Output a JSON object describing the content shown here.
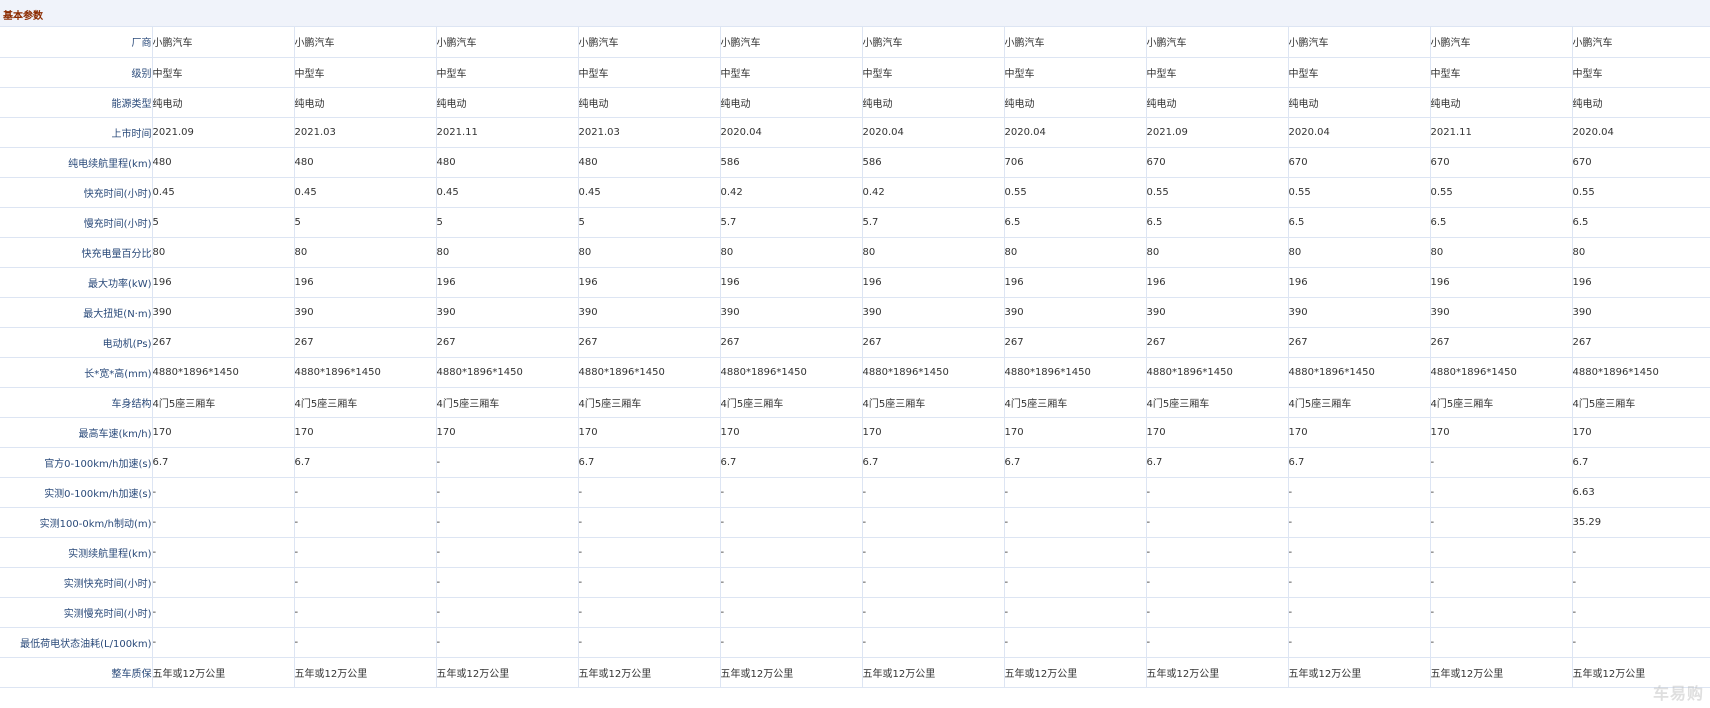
{
  "section": {
    "title": "基本参数"
  },
  "watermark": "车易购",
  "rows": [
    {
      "label": "厂商",
      "values": [
        "小鹏汽车",
        "小鹏汽车",
        "小鹏汽车",
        "小鹏汽车",
        "小鹏汽车",
        "小鹏汽车",
        "小鹏汽车",
        "小鹏汽车",
        "小鹏汽车",
        "小鹏汽车",
        "小鹏汽车"
      ]
    },
    {
      "label": "级别",
      "values": [
        "中型车",
        "中型车",
        "中型车",
        "中型车",
        "中型车",
        "中型车",
        "中型车",
        "中型车",
        "中型车",
        "中型车",
        "中型车"
      ]
    },
    {
      "label": "能源类型",
      "values": [
        "纯电动",
        "纯电动",
        "纯电动",
        "纯电动",
        "纯电动",
        "纯电动",
        "纯电动",
        "纯电动",
        "纯电动",
        "纯电动",
        "纯电动"
      ]
    },
    {
      "label": "上市时间",
      "values": [
        "2021.09",
        "2021.03",
        "2021.11",
        "2021.03",
        "2020.04",
        "2020.04",
        "2020.04",
        "2021.09",
        "2020.04",
        "2021.11",
        "2020.04"
      ]
    },
    {
      "label": "纯电续航里程(km)",
      "values": [
        "480",
        "480",
        "480",
        "480",
        "586",
        "586",
        "706",
        "670",
        "670",
        "670",
        "670"
      ]
    },
    {
      "label": "快充时间(小时)",
      "values": [
        "0.45",
        "0.45",
        "0.45",
        "0.45",
        "0.42",
        "0.42",
        "0.55",
        "0.55",
        "0.55",
        "0.55",
        "0.55"
      ]
    },
    {
      "label": "慢充时间(小时)",
      "values": [
        "5",
        "5",
        "5",
        "5",
        "5.7",
        "5.7",
        "6.5",
        "6.5",
        "6.5",
        "6.5",
        "6.5"
      ]
    },
    {
      "label": "快充电量百分比",
      "values": [
        "80",
        "80",
        "80",
        "80",
        "80",
        "80",
        "80",
        "80",
        "80",
        "80",
        "80"
      ]
    },
    {
      "label": "最大功率(kW)",
      "values": [
        "196",
        "196",
        "196",
        "196",
        "196",
        "196",
        "196",
        "196",
        "196",
        "196",
        "196"
      ]
    },
    {
      "label": "最大扭矩(N·m)",
      "values": [
        "390",
        "390",
        "390",
        "390",
        "390",
        "390",
        "390",
        "390",
        "390",
        "390",
        "390"
      ]
    },
    {
      "label": "电动机(Ps)",
      "values": [
        "267",
        "267",
        "267",
        "267",
        "267",
        "267",
        "267",
        "267",
        "267",
        "267",
        "267"
      ]
    },
    {
      "label": "长*宽*高(mm)",
      "values": [
        "4880*1896*1450",
        "4880*1896*1450",
        "4880*1896*1450",
        "4880*1896*1450",
        "4880*1896*1450",
        "4880*1896*1450",
        "4880*1896*1450",
        "4880*1896*1450",
        "4880*1896*1450",
        "4880*1896*1450",
        "4880*1896*1450"
      ]
    },
    {
      "label": "车身结构",
      "values": [
        "4门5座三厢车",
        "4门5座三厢车",
        "4门5座三厢车",
        "4门5座三厢车",
        "4门5座三厢车",
        "4门5座三厢车",
        "4门5座三厢车",
        "4门5座三厢车",
        "4门5座三厢车",
        "4门5座三厢车",
        "4门5座三厢车"
      ]
    },
    {
      "label": "最高车速(km/h)",
      "values": [
        "170",
        "170",
        "170",
        "170",
        "170",
        "170",
        "170",
        "170",
        "170",
        "170",
        "170"
      ]
    },
    {
      "label": "官方0-100km/h加速(s)",
      "values": [
        "6.7",
        "6.7",
        "-",
        "6.7",
        "6.7",
        "6.7",
        "6.7",
        "6.7",
        "6.7",
        "-",
        "6.7"
      ]
    },
    {
      "label": "实测0-100km/h加速(s)",
      "values": [
        "-",
        "-",
        "-",
        "-",
        "-",
        "-",
        "-",
        "-",
        "-",
        "-",
        "6.63"
      ]
    },
    {
      "label": "实测100-0km/h制动(m)",
      "values": [
        "-",
        "-",
        "-",
        "-",
        "-",
        "-",
        "-",
        "-",
        "-",
        "-",
        "35.29"
      ]
    },
    {
      "label": "实测续航里程(km)",
      "values": [
        "-",
        "-",
        "-",
        "-",
        "-",
        "-",
        "-",
        "-",
        "-",
        "-",
        "-"
      ]
    },
    {
      "label": "实测快充时间(小时)",
      "values": [
        "-",
        "-",
        "-",
        "-",
        "-",
        "-",
        "-",
        "-",
        "-",
        "-",
        "-"
      ]
    },
    {
      "label": "实测慢充时间(小时)",
      "values": [
        "-",
        "-",
        "-",
        "-",
        "-",
        "-",
        "-",
        "-",
        "-",
        "-",
        "-"
      ]
    },
    {
      "label": "最低荷电状态油耗(L/100km)",
      "values": [
        "-",
        "-",
        "-",
        "-",
        "-",
        "-",
        "-",
        "-",
        "-",
        "-",
        "-"
      ]
    },
    {
      "label": "整车质保",
      "values": [
        "五年或12万公里",
        "五年或12万公里",
        "五年或12万公里",
        "五年或12万公里",
        "五年或12万公里",
        "五年或12万公里",
        "五年或12万公里",
        "五年或12万公里",
        "五年或12万公里",
        "五年或12万公里",
        "五年或12万公里"
      ]
    }
  ]
}
